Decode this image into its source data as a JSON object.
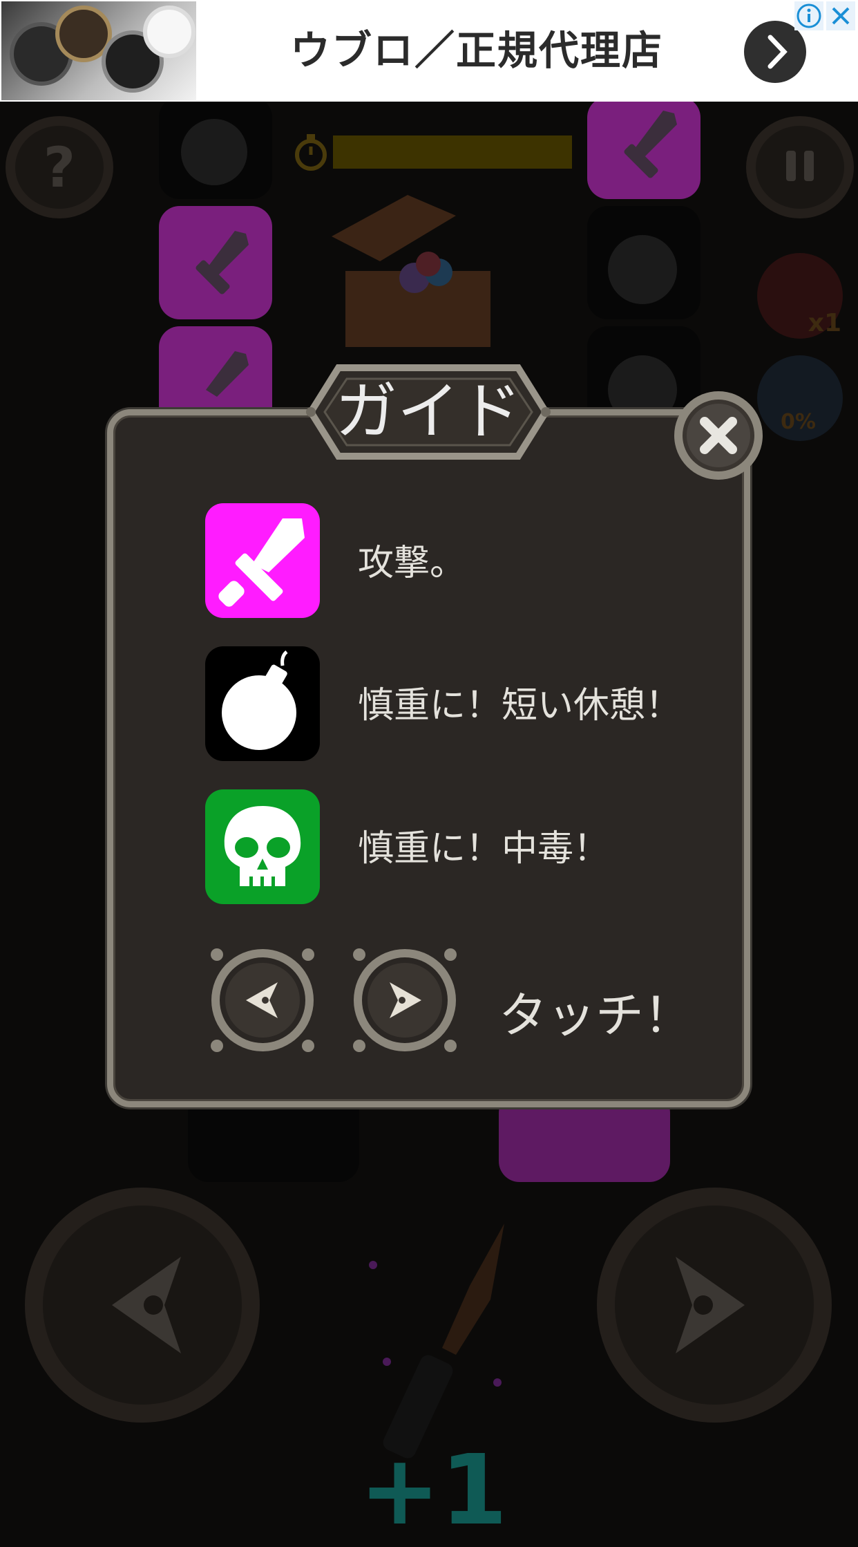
{
  "ad": {
    "title": "ウブロ／正規代理店",
    "go_icon": "chevron-right-icon",
    "info_icon": "info-icon",
    "close_icon": "close-icon"
  },
  "hud": {
    "help_icon": "question-icon",
    "timer_icon": "stopwatch-icon",
    "pause_icon": "pause-icon",
    "item1_count": "x1",
    "item2_percent": "0%",
    "timer_color": "#3d3300"
  },
  "guide": {
    "title": "ガイド",
    "items": [
      {
        "icon": "sword-icon",
        "text": "攻撃。",
        "color": "#ff1cff"
      },
      {
        "icon": "bomb-icon",
        "text": "慎重に！短い休憩！",
        "color": "#000000"
      },
      {
        "icon": "skull-icon",
        "text": "慎重に！中毒！",
        "color": "#0aa128"
      }
    ],
    "touch_text": "タッチ！"
  },
  "score": {
    "plus": "+1"
  }
}
